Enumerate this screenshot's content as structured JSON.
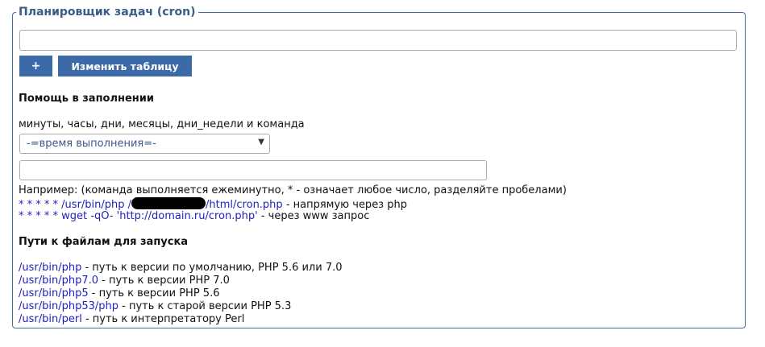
{
  "fieldset": {
    "legend": "Планировщик задач (cron)"
  },
  "crontab_input": {
    "value": ""
  },
  "buttons": {
    "add_label": "+",
    "edit_table_label": "Изменить таблицу"
  },
  "help": {
    "heading": "Помощь в заполнении",
    "fields_caption": "минуты, часы, дни, месяцы, дни_недели и команда",
    "time_select_value": "-=время выполнения=-",
    "command_input_value": "",
    "example_caption": "Например: (команда выполняется ежеминутно, * - означает любое число, разделяйте пробелами)",
    "example1": {
      "stars": "* * * * *",
      "path_start": "/usr/bin/php /",
      "path_end": "/html/cron.php",
      "note": " - напрямую через php"
    },
    "example2": {
      "stars": "* * * * *",
      "command": "wget -qO- 'http://domain.ru/cron.php'",
      "note": " - через www запрос"
    }
  },
  "paths": {
    "heading": "Пути к файлам для запуска",
    "items": [
      {
        "path": "/usr/bin/php",
        "desc": " - путь к версии по умолчанию, PHP 5.6 или 7.0"
      },
      {
        "path": "/usr/bin/php7.0",
        "desc": " - путь к версии PHP 7.0"
      },
      {
        "path": "/usr/bin/php5",
        "desc": " - путь к версии PHP 5.6"
      },
      {
        "path": "/usr/bin/php53/php",
        "desc": " - путь к старой версии PHP 5.3"
      },
      {
        "path": "/usr/bin/perl",
        "desc": " - путь к интерпретатору Perl"
      }
    ]
  },
  "colors": {
    "accent": "#3c6aa8",
    "border": "#4a6a9a",
    "link": "#2222bb"
  },
  "icons": {
    "select_arrow": "chevron-down-icon"
  }
}
